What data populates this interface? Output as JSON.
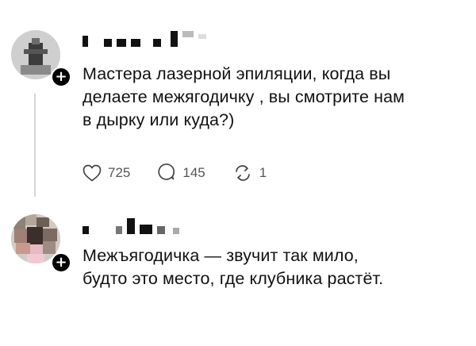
{
  "posts": [
    {
      "author_name": "",
      "text": "Мастера лазерной эпиляции, когда вы\nделаете межягодичку , вы смотрите нам\nв дырку или куда?)",
      "follow_icon": "plus-icon",
      "actions": {
        "likes": "725",
        "comments": "145",
        "reposts": "1"
      },
      "icons": [
        "heart-icon",
        "comment-icon",
        "repost-icon"
      ]
    },
    {
      "author_name": "",
      "text": "Межъягодичка — звучит так мило,\nбудто это место, где клубника растёт.",
      "follow_icon": "plus-icon"
    }
  ],
  "colors": {
    "text": "#111111",
    "muted": "#555555",
    "thread_line": "#d6d6d6",
    "background": "#ffffff"
  }
}
